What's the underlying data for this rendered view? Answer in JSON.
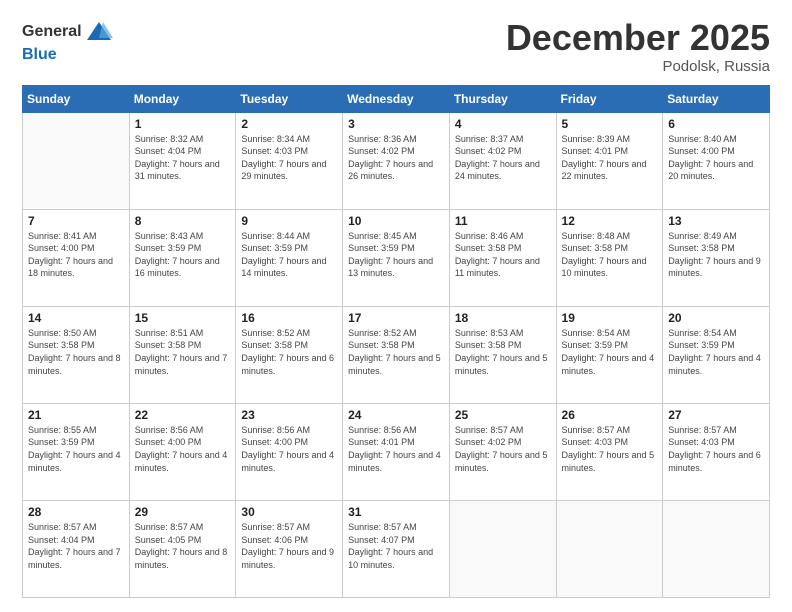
{
  "logo": {
    "general": "General",
    "blue": "Blue"
  },
  "title": "December 2025",
  "location": "Podolsk, Russia",
  "header": {
    "days": [
      "Sunday",
      "Monday",
      "Tuesday",
      "Wednesday",
      "Thursday",
      "Friday",
      "Saturday"
    ]
  },
  "weeks": [
    [
      {
        "day": "",
        "sunrise": "",
        "sunset": "",
        "daylight": ""
      },
      {
        "day": "1",
        "sunrise": "Sunrise: 8:32 AM",
        "sunset": "Sunset: 4:04 PM",
        "daylight": "Daylight: 7 hours and 31 minutes."
      },
      {
        "day": "2",
        "sunrise": "Sunrise: 8:34 AM",
        "sunset": "Sunset: 4:03 PM",
        "daylight": "Daylight: 7 hours and 29 minutes."
      },
      {
        "day": "3",
        "sunrise": "Sunrise: 8:36 AM",
        "sunset": "Sunset: 4:02 PM",
        "daylight": "Daylight: 7 hours and 26 minutes."
      },
      {
        "day": "4",
        "sunrise": "Sunrise: 8:37 AM",
        "sunset": "Sunset: 4:02 PM",
        "daylight": "Daylight: 7 hours and 24 minutes."
      },
      {
        "day": "5",
        "sunrise": "Sunrise: 8:39 AM",
        "sunset": "Sunset: 4:01 PM",
        "daylight": "Daylight: 7 hours and 22 minutes."
      },
      {
        "day": "6",
        "sunrise": "Sunrise: 8:40 AM",
        "sunset": "Sunset: 4:00 PM",
        "daylight": "Daylight: 7 hours and 20 minutes."
      }
    ],
    [
      {
        "day": "7",
        "sunrise": "Sunrise: 8:41 AM",
        "sunset": "Sunset: 4:00 PM",
        "daylight": "Daylight: 7 hours and 18 minutes."
      },
      {
        "day": "8",
        "sunrise": "Sunrise: 8:43 AM",
        "sunset": "Sunset: 3:59 PM",
        "daylight": "Daylight: 7 hours and 16 minutes."
      },
      {
        "day": "9",
        "sunrise": "Sunrise: 8:44 AM",
        "sunset": "Sunset: 3:59 PM",
        "daylight": "Daylight: 7 hours and 14 minutes."
      },
      {
        "day": "10",
        "sunrise": "Sunrise: 8:45 AM",
        "sunset": "Sunset: 3:59 PM",
        "daylight": "Daylight: 7 hours and 13 minutes."
      },
      {
        "day": "11",
        "sunrise": "Sunrise: 8:46 AM",
        "sunset": "Sunset: 3:58 PM",
        "daylight": "Daylight: 7 hours and 11 minutes."
      },
      {
        "day": "12",
        "sunrise": "Sunrise: 8:48 AM",
        "sunset": "Sunset: 3:58 PM",
        "daylight": "Daylight: 7 hours and 10 minutes."
      },
      {
        "day": "13",
        "sunrise": "Sunrise: 8:49 AM",
        "sunset": "Sunset: 3:58 PM",
        "daylight": "Daylight: 7 hours and 9 minutes."
      }
    ],
    [
      {
        "day": "14",
        "sunrise": "Sunrise: 8:50 AM",
        "sunset": "Sunset: 3:58 PM",
        "daylight": "Daylight: 7 hours and 8 minutes."
      },
      {
        "day": "15",
        "sunrise": "Sunrise: 8:51 AM",
        "sunset": "Sunset: 3:58 PM",
        "daylight": "Daylight: 7 hours and 7 minutes."
      },
      {
        "day": "16",
        "sunrise": "Sunrise: 8:52 AM",
        "sunset": "Sunset: 3:58 PM",
        "daylight": "Daylight: 7 hours and 6 minutes."
      },
      {
        "day": "17",
        "sunrise": "Sunrise: 8:52 AM",
        "sunset": "Sunset: 3:58 PM",
        "daylight": "Daylight: 7 hours and 5 minutes."
      },
      {
        "day": "18",
        "sunrise": "Sunrise: 8:53 AM",
        "sunset": "Sunset: 3:58 PM",
        "daylight": "Daylight: 7 hours and 5 minutes."
      },
      {
        "day": "19",
        "sunrise": "Sunrise: 8:54 AM",
        "sunset": "Sunset: 3:59 PM",
        "daylight": "Daylight: 7 hours and 4 minutes."
      },
      {
        "day": "20",
        "sunrise": "Sunrise: 8:54 AM",
        "sunset": "Sunset: 3:59 PM",
        "daylight": "Daylight: 7 hours and 4 minutes."
      }
    ],
    [
      {
        "day": "21",
        "sunrise": "Sunrise: 8:55 AM",
        "sunset": "Sunset: 3:59 PM",
        "daylight": "Daylight: 7 hours and 4 minutes."
      },
      {
        "day": "22",
        "sunrise": "Sunrise: 8:56 AM",
        "sunset": "Sunset: 4:00 PM",
        "daylight": "Daylight: 7 hours and 4 minutes."
      },
      {
        "day": "23",
        "sunrise": "Sunrise: 8:56 AM",
        "sunset": "Sunset: 4:00 PM",
        "daylight": "Daylight: 7 hours and 4 minutes."
      },
      {
        "day": "24",
        "sunrise": "Sunrise: 8:56 AM",
        "sunset": "Sunset: 4:01 PM",
        "daylight": "Daylight: 7 hours and 4 minutes."
      },
      {
        "day": "25",
        "sunrise": "Sunrise: 8:57 AM",
        "sunset": "Sunset: 4:02 PM",
        "daylight": "Daylight: 7 hours and 5 minutes."
      },
      {
        "day": "26",
        "sunrise": "Sunrise: 8:57 AM",
        "sunset": "Sunset: 4:03 PM",
        "daylight": "Daylight: 7 hours and 5 minutes."
      },
      {
        "day": "27",
        "sunrise": "Sunrise: 8:57 AM",
        "sunset": "Sunset: 4:03 PM",
        "daylight": "Daylight: 7 hours and 6 minutes."
      }
    ],
    [
      {
        "day": "28",
        "sunrise": "Sunrise: 8:57 AM",
        "sunset": "Sunset: 4:04 PM",
        "daylight": "Daylight: 7 hours and 7 minutes."
      },
      {
        "day": "29",
        "sunrise": "Sunrise: 8:57 AM",
        "sunset": "Sunset: 4:05 PM",
        "daylight": "Daylight: 7 hours and 8 minutes."
      },
      {
        "day": "30",
        "sunrise": "Sunrise: 8:57 AM",
        "sunset": "Sunset: 4:06 PM",
        "daylight": "Daylight: 7 hours and 9 minutes."
      },
      {
        "day": "31",
        "sunrise": "Sunrise: 8:57 AM",
        "sunset": "Sunset: 4:07 PM",
        "daylight": "Daylight: 7 hours and 10 minutes."
      },
      {
        "day": "",
        "sunrise": "",
        "sunset": "",
        "daylight": ""
      },
      {
        "day": "",
        "sunrise": "",
        "sunset": "",
        "daylight": ""
      },
      {
        "day": "",
        "sunrise": "",
        "sunset": "",
        "daylight": ""
      }
    ]
  ]
}
